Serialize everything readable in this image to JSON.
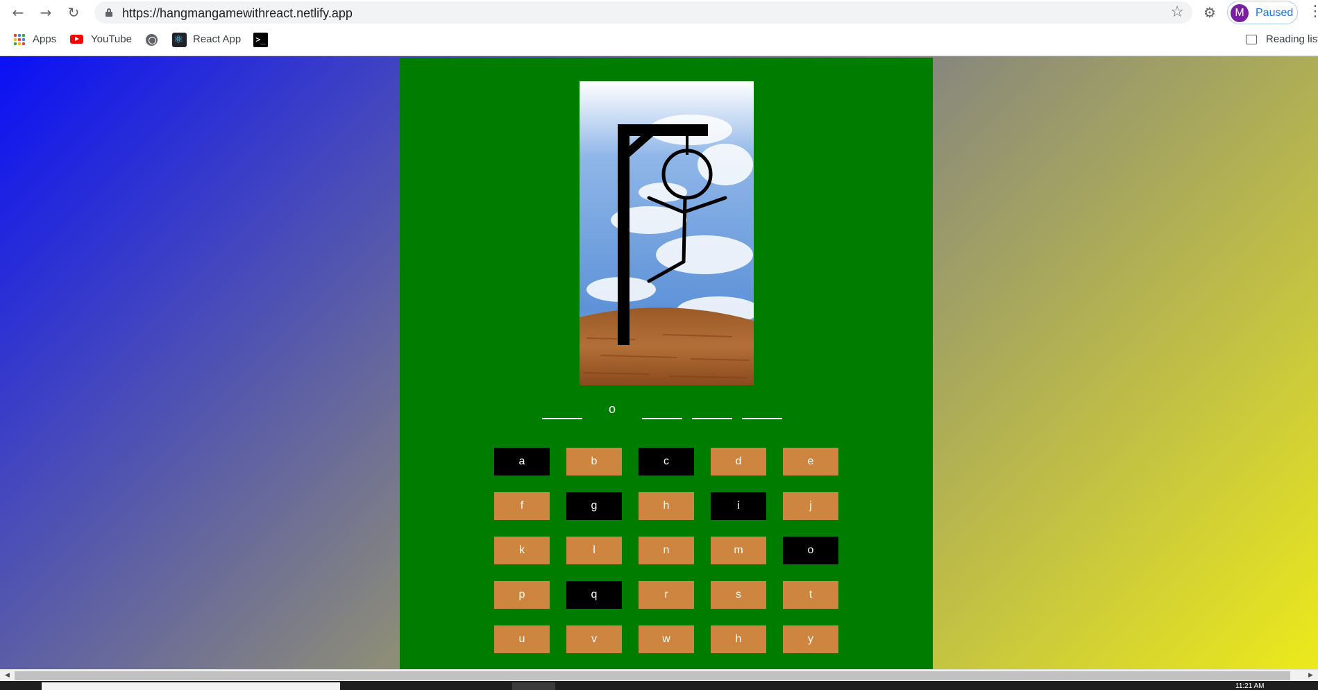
{
  "browser": {
    "url": "https://hangmangamewithreact.netlify.app",
    "profile_initial": "M",
    "profile_status": "Paused",
    "bookmarks": [
      "Apps",
      "YouTube",
      "React App"
    ],
    "reading_list": "Reading list"
  },
  "game": {
    "word_slots": [
      "",
      "o",
      "",
      "",
      ""
    ],
    "keys": [
      {
        "letter": "a",
        "state": "used"
      },
      {
        "letter": "b",
        "state": "available"
      },
      {
        "letter": "c",
        "state": "used"
      },
      {
        "letter": "d",
        "state": "available"
      },
      {
        "letter": "e",
        "state": "available"
      },
      {
        "letter": "f",
        "state": "available"
      },
      {
        "letter": "g",
        "state": "used"
      },
      {
        "letter": "h",
        "state": "available"
      },
      {
        "letter": "i",
        "state": "used"
      },
      {
        "letter": "j",
        "state": "available"
      },
      {
        "letter": "k",
        "state": "available"
      },
      {
        "letter": "l",
        "state": "available"
      },
      {
        "letter": "n",
        "state": "available"
      },
      {
        "letter": "m",
        "state": "available"
      },
      {
        "letter": "o",
        "state": "used"
      },
      {
        "letter": "p",
        "state": "available"
      },
      {
        "letter": "q",
        "state": "used"
      },
      {
        "letter": "r",
        "state": "available"
      },
      {
        "letter": "s",
        "state": "available"
      },
      {
        "letter": "t",
        "state": "available"
      },
      {
        "letter": "u",
        "state": "available"
      },
      {
        "letter": "v",
        "state": "available"
      },
      {
        "letter": "w",
        "state": "available"
      },
      {
        "letter": "h",
        "state": "available"
      },
      {
        "letter": "y",
        "state": "available"
      }
    ]
  },
  "taskbar": {
    "clock": "11:21 AM"
  },
  "colors": {
    "game_bg": "#007c00",
    "key_available": "#cd853f",
    "key_used": "#000000",
    "page_gradient_start": "#0a10f5",
    "page_gradient_end": "#ecea1a"
  },
  "icons": [
    "back-arrow-icon",
    "forward-arrow-icon",
    "reload-icon",
    "lock-icon",
    "star-icon",
    "extensions-icon",
    "menu-icon",
    "apps-grid-icon",
    "youtube-icon",
    "globe-icon",
    "react-icon",
    "terminal-icon",
    "reading-list-icon"
  ]
}
